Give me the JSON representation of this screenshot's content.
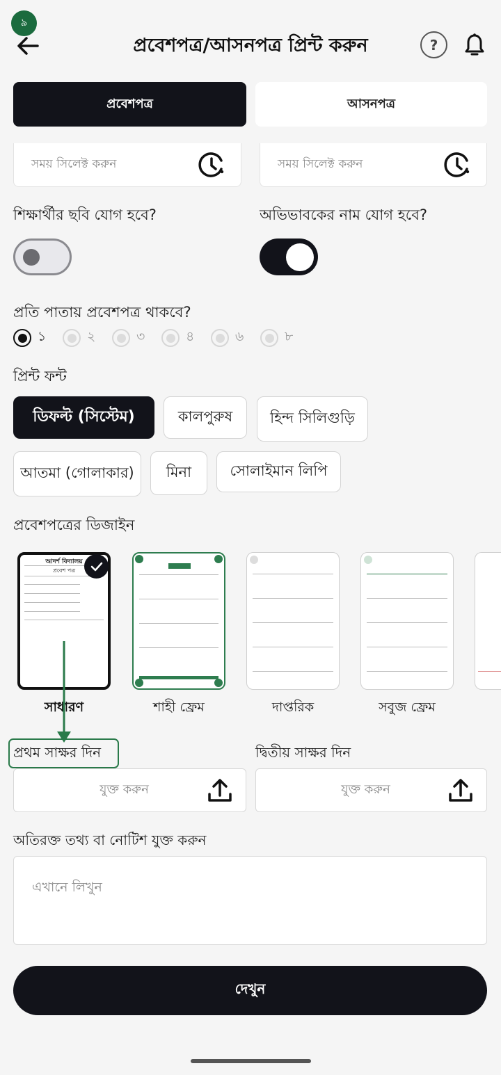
{
  "status": {
    "badge": "৯"
  },
  "header": {
    "title": "প্রবেশপত্র/আসনপত্র প্রিন্ট করুন",
    "help_label": "?"
  },
  "tabs": [
    {
      "label": "প্রবেশপত্র",
      "active": true
    },
    {
      "label": "আসনপত্র",
      "active": false
    }
  ],
  "time_fields": [
    {
      "placeholder": "সময় সিলেক্ট করুন"
    },
    {
      "placeholder": "সময় সিলেক্ট করুন"
    }
  ],
  "toggles": [
    {
      "label": "শিক্ষার্থীর ছবি যোগ হবে?",
      "on": false
    },
    {
      "label": "অভিভাবকের নাম যোগ হবে?",
      "on": true
    }
  ],
  "per_page": {
    "label": "প্রতি পাতায় প্রবেশপত্র থাকবে?",
    "options": [
      "১",
      "২",
      "৩",
      "৪",
      "৬",
      "৮"
    ],
    "selected": "১"
  },
  "print_font": {
    "label": "প্রিন্ট ফন্ট",
    "options": [
      "ডিফল্ট (সিস্টেম)",
      "কালপুরুষ",
      "হিন্দ সিলিগুড়ি",
      "আতমা (গোলাকার)",
      "মিনা",
      "সোলাইমান লিপি"
    ],
    "selected": "ডিফল্ট (সিস্টেম)"
  },
  "design": {
    "label": "প্রবেশপত্রের ডিজাইন",
    "options": [
      "সাধারণ",
      "শাহী ফ্রেম",
      "দাপ্তরিক",
      "সবুজ ফ্রেম"
    ],
    "selected": "সাধারণ",
    "preview": {
      "school": "আদর্শ বিদ্যালয়",
      "doc": "প্রবেশ পত্র"
    }
  },
  "signatures": {
    "first_label": "প্রথম সাক্ষর দিন",
    "second_label": "দ্বিতীয় সাক্ষর দিন",
    "upload_label": "যুক্ত করুন"
  },
  "notes": {
    "label": "অতিরক্ত তথ্য বা নোটিশ যুক্ত করুন",
    "placeholder": "এখানে লিখুন"
  },
  "view_button": "দেখুন",
  "colors": {
    "primary": "#12131a",
    "accent_green": "#2a7a4a",
    "background": "#f5f5f5"
  }
}
